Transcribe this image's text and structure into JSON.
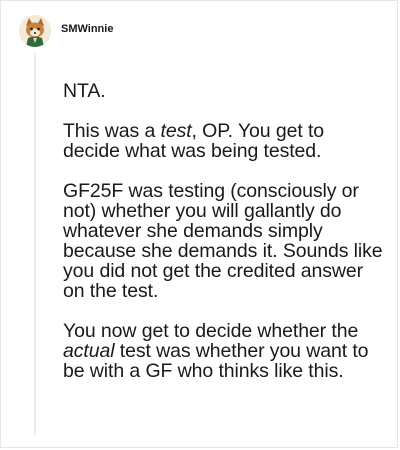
{
  "comment": {
    "author": "SMWinnie",
    "avatar_icon": "fox-avatar-icon",
    "paragraphs": [
      {
        "segments": [
          {
            "text": "NTA.",
            "italic": false
          }
        ]
      },
      {
        "segments": [
          {
            "text": "This was a ",
            "italic": false
          },
          {
            "text": "test",
            "italic": true
          },
          {
            "text": ", OP. You get to decide what was being tested.",
            "italic": false
          }
        ]
      },
      {
        "segments": [
          {
            "text": "GF25F was testing (consciously or not) whether you will gallantly do whatever she demands simply because she demands it. Sounds like you did not get the credited answer on the test.",
            "italic": false
          }
        ]
      },
      {
        "segments": [
          {
            "text": "You now get to decide whether the ",
            "italic": false
          },
          {
            "text": "actual",
            "italic": true
          },
          {
            "text": " test was whether you want to be with a GF who thinks like this.",
            "italic": false
          }
        ]
      }
    ]
  },
  "colors": {
    "text": "#1a1a1b",
    "thread_line": "#ececec",
    "border": "#e6e6e6"
  }
}
